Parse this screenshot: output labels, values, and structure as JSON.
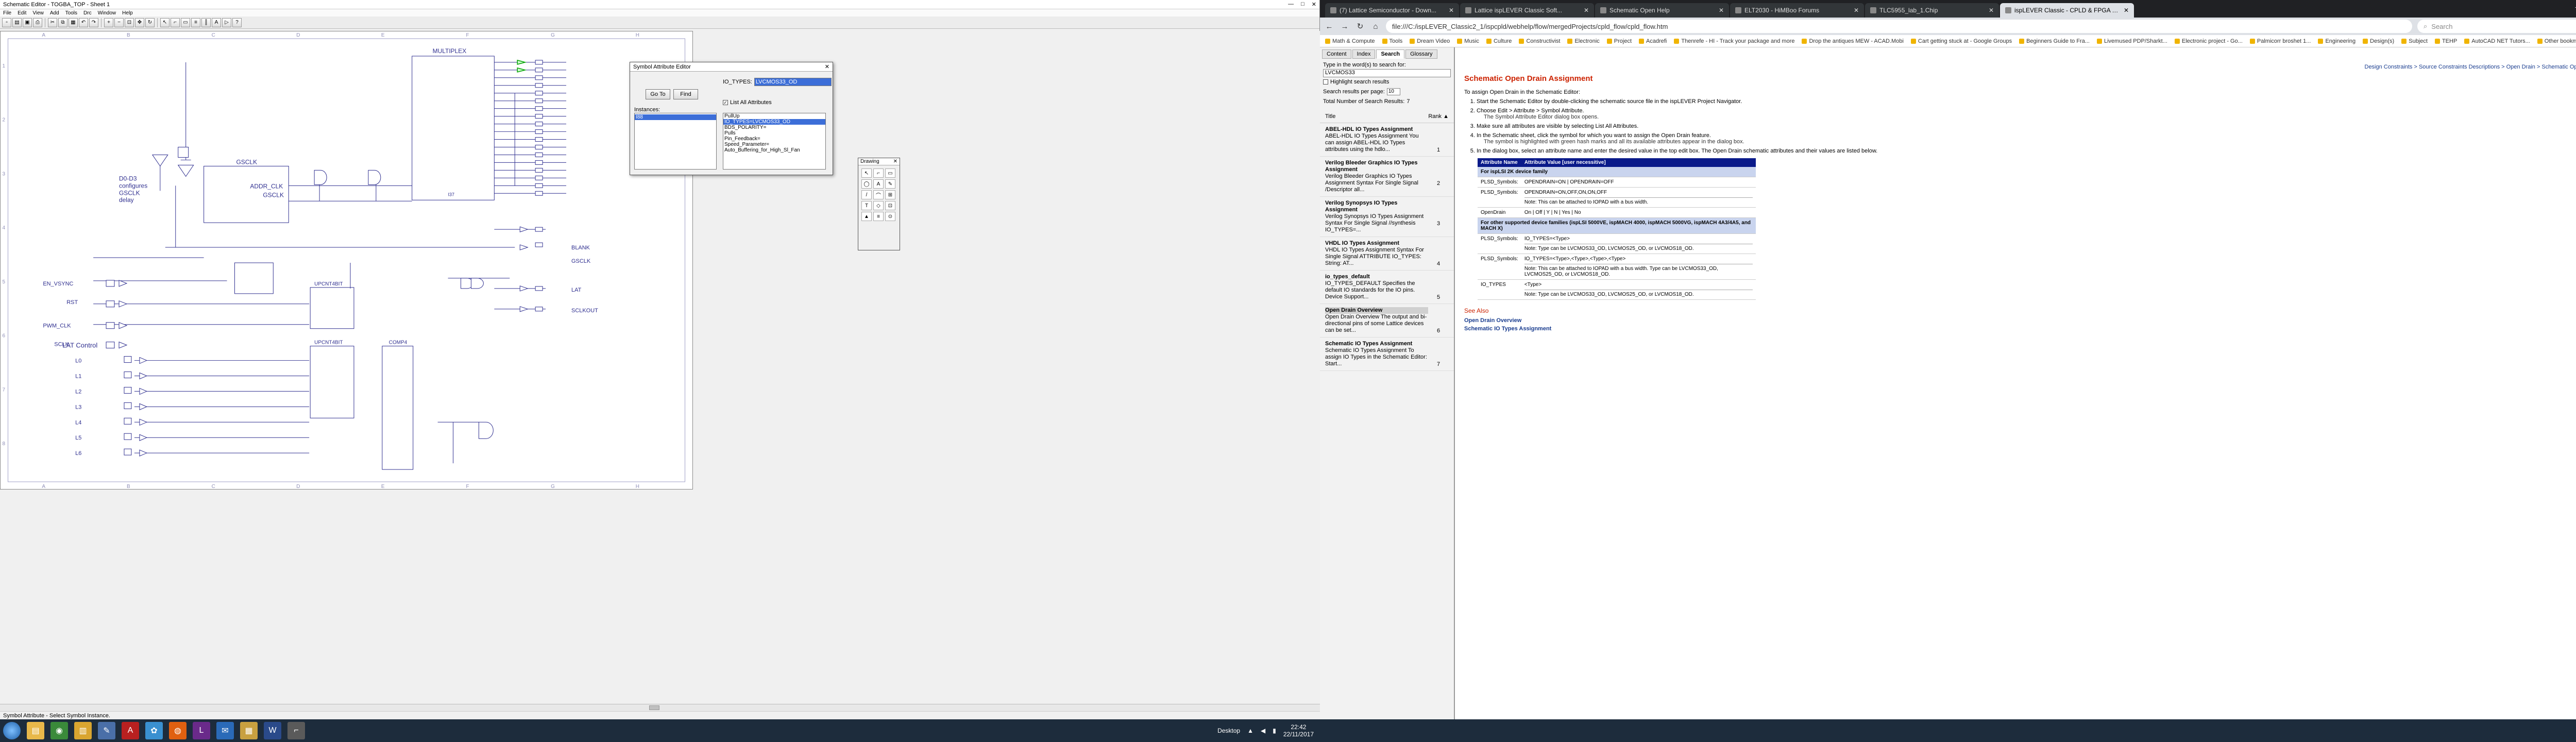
{
  "sched": {
    "title": "Schematic Editor - TOGBA_TOP - Sheet 1",
    "menu": [
      "File",
      "Edit",
      "View",
      "Add",
      "Tools",
      "Drc",
      "Window",
      "Help"
    ],
    "status": "Symbol Attribute - Select Symbol Instance."
  },
  "dialog": {
    "title": "Symbol Attribute Editor",
    "attr_label": "IO_TYPES:",
    "attr_value": "LVCMOS33_OD",
    "goto": "Go To",
    "find": "Find",
    "list_all": "List All Attributes",
    "instances_label": "Instances:",
    "instance_selected": "I88",
    "attributes": [
      "PullUp",
      "IO_TYPES=LVCMOS33_OD",
      "BDS_POLARITY=",
      "Pulls",
      "Pin_Feedback=",
      "Speed_Parameter=",
      "Auto_Buffering_for_High_Sl_Fan"
    ],
    "attr_selected_index": 1
  },
  "drawing": {
    "title": "Drawing",
    "tools": [
      "↖",
      "⌐",
      "▭",
      "◯",
      "A",
      "✎",
      "/",
      "⌒",
      "⊞",
      "T",
      "◇",
      "⊡",
      "▲",
      "≡",
      "⊙"
    ]
  },
  "schem": {
    "labels": {
      "mux": "MULTIPLEX",
      "gsclk_blk": "GSCLK",
      "addr_clk": "ADDR_CLK",
      "gsclk_out": "GSCLK",
      "note1": "D0-D3",
      "note2": "configures",
      "note3": "GSCLK",
      "note4": "delay",
      "lat_ctrl": "LAT Control",
      "inputs": [
        "EN_VSYNC",
        "RST",
        "PWM_CLK",
        "SCLK"
      ],
      "outputs": [
        "BLANK",
        "GSCLK",
        "LAT",
        "SCLKOUT"
      ],
      "lat_in": [
        "L0",
        "L1",
        "L2",
        "L3",
        "L4",
        "L5",
        "L6"
      ],
      "cnt1": "UPCNT4BIT",
      "cnt2": "UPCNT4BIT",
      "comp": "COMP4",
      "mux_inst": "I37"
    },
    "column_marks": [
      "A",
      "B",
      "C",
      "D",
      "E",
      "F",
      "G",
      "H"
    ],
    "row_marks": [
      "1",
      "2",
      "3",
      "4",
      "5",
      "6",
      "7",
      "8"
    ]
  },
  "taskbar": {
    "apps": [
      "Explorer",
      "Chrome",
      "Files",
      "Notepad",
      "Acrobat",
      "Paint",
      "Firefox",
      "Lattice",
      "Mail",
      "Docs",
      "Word",
      "Schematic"
    ],
    "desktop": "Desktop",
    "time": "22:42",
    "date": "22/11/2017"
  },
  "browser": {
    "tabs": [
      "(7) Lattice Semiconductor - Down...",
      "Lattice ispLEVER Classic Soft...",
      "Schematic Open Help",
      "ELT2030 - HiMBoo Forums",
      "TLC5955_lab_1.Chip",
      "ispLEVER Classic - CPLD & FPGA D..."
    ],
    "active_tab": 5,
    "url": "file:///C:/ispLEVER_Classic2_1/ispcpld/webhelp/flow/mergedProjects/cpld_flow/cpld_flow.htm",
    "search_placeholder": "Search",
    "bookmarks": [
      "Math & Compute",
      "Tools",
      "Dream Video",
      "Music",
      "Culture",
      "Constructivist",
      "Electronic",
      "Project",
      "Acadrefi",
      "Thenrefe - HI - Track your package and more",
      "Drop the antiques MEW - ACAD.Mobi",
      "Cart getting stuck at - Google Groups",
      "Beginners Guide to Fra...",
      "Livemused PDP/Sharkt...",
      "Electronic project - Go...",
      "Palmicorr broshet 1...",
      "Engineering",
      "Design(s)",
      "Subject",
      "TEHP",
      "AutoCAD NET Tutors...",
      "Other bookmarks"
    ]
  },
  "help": {
    "tabs": [
      "Content",
      "Index",
      "Search",
      "Glossary"
    ],
    "active_tab": 2,
    "search_label": "Type in the word(s) to search for:",
    "search_value": "LVCMOS33",
    "highlight": "Highlight search results",
    "results_per_page_label": "Search results per page:",
    "results_per_page": "10",
    "total_label": "Total Number of Search Results:",
    "total": "7",
    "col_title": "Title",
    "col_rank": "Rank",
    "results": [
      {
        "title": "ABEL-HDL IO Types Assignment",
        "desc": "ABEL-HDL IO Types Assignment You can assign ABEL-HDL IO Types attributes using the hdlo...",
        "rank": "1"
      },
      {
        "title": "Verilog Bleeder Graphics IO Types Assignment",
        "desc": "Verilog Bleeder Graphics IO Types Assignment Syntax For Single Signal /Descriptor all...",
        "rank": "2"
      },
      {
        "title": "Verilog Synopsys IO Types Assignment",
        "desc": "Verilog Synopsys IO Types Assignment Syntax For Single Signal //synthesis IO_TYPES=...",
        "rank": "3"
      },
      {
        "title": "VHDL IO Types Assignment",
        "desc": "VHDL IO Types Assignment Syntax For Single Signal ATTRIBUTE IO_TYPES: String: AT...",
        "rank": "4"
      },
      {
        "title": "io_types_default",
        "desc": "IO_TYPES_DEFAULT Specifies the default IO standards for the IO pins. Device Support...",
        "rank": "5"
      },
      {
        "title": "Open Drain Overview",
        "desc": "Open Drain Overview The output and bi-directional pins of some Lattice devices can be set...",
        "rank": "6"
      },
      {
        "title": "Schematic IO Types Assignment",
        "desc": "Schematic IO Types Assignment To assign IO Types in the Schematic Editor: Start...",
        "rank": "7"
      }
    ],
    "breadcrumbs": "Design Constraints > Source Constraints Descriptions > Open Drain > Schematic Open Drain Assignment",
    "heading": "Schematic Open Drain Assignment",
    "intro": "To assign Open Drain in the Schematic Editor:",
    "steps": [
      "Start the Schematic Editor by double-clicking the schematic source file in the ispLEVER Project Navigator.",
      "Choose Edit > Attribute > Symbol Attribute.",
      "Make sure all attributes are visible by selecting List All Attributes.",
      "In the Schematic sheet, click the symbol for which you want to assign the Open Drain feature.",
      "In the dialog box, select an attribute name and enter the desired value in the top edit box. The Open Drain schematic attributes and their values are listed below."
    ],
    "step2_note": "The Symbol Attribute Editor dialog box opens.",
    "step4_note": "The symbol is highlighted with green hash marks and all its available attributes appear in the dialog box.",
    "table": {
      "h_name": "Attribute Name",
      "h_value": "Attribute Value",
      "h_value_note": "[user necessitive]",
      "sec1": "For ispLSI 2K device family",
      "rows1": [
        {
          "name": "PLSD_Symbols:",
          "value": "OPENDRAIN=ON | OPENDRAIN=OFF",
          "note": ""
        },
        {
          "name": "PLSD_Symbols:",
          "value": "OPENDRAIN=ON,OFF,ON,ON,OFF",
          "note": "Note: This can be attached to IOPAD with a bus width."
        },
        {
          "name": "OpenDrain",
          "value": "On | Off | Y | N | Yes | No",
          "note": ""
        }
      ],
      "sec2": "For other supported device families (ispLSI 5000VE, ispMACH 4000, ispMACH 5000VG, ispMACH 4A3/4A5, and MACH X)",
      "rows2": [
        {
          "name": "PLSD_Symbols:",
          "value": "IO_TYPES=<Type>",
          "note": "Note: Type can be LVCMOS33_OD, LVCMOS25_OD, or LVCMOS18_OD."
        },
        {
          "name": "PLSD_Symbols:",
          "value": "IO_TYPES=<Type>,<Type>,<Type>,<Type>",
          "note": "Note: This can be attached to IOPAD with a bus width. Type can be LVCMOS33_OD, LVCMOS25_OD, or LVCMOS18_OD."
        },
        {
          "name": "IO_TYPES",
          "value": "<Type>",
          "note": "Note: Type can be LVCMOS33_OD, LVCMOS25_OD, or LVCMOS18_OD."
        }
      ]
    },
    "see_also": "See Also",
    "links": [
      "Open Drain Overview",
      "Schematic IO Types Assignment"
    ]
  }
}
